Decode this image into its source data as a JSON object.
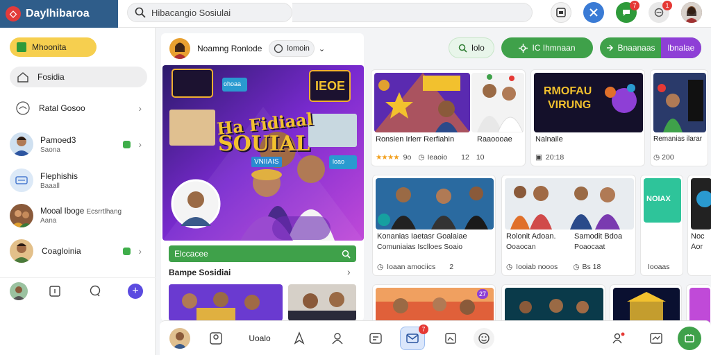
{
  "app": {
    "brand_name": "Daylhibaroa",
    "brand_glyph": "◇"
  },
  "search": {
    "placeholder": "Hibacangio Sosiulai"
  },
  "top_badges": {
    "chat": "7",
    "notifications": "1"
  },
  "sidebar": {
    "primary_label": "Mhoonita",
    "items": [
      {
        "label": "Fosidia",
        "sub": ""
      },
      {
        "label": "Ratal Gosoo",
        "sub": ""
      },
      {
        "label": "Pamoed3",
        "sub": "Saona"
      },
      {
        "label": "Flephishis",
        "sub": "Baaall"
      },
      {
        "label": "Mooal Iboge",
        "sub": "Aana",
        "extra": "Ecsrrtlhang"
      },
      {
        "label": "Coagloinia",
        "sub": ""
      }
    ]
  },
  "feed": {
    "user_name": "Noamng Ronlode",
    "chip_label": "lomoin",
    "hero_title_1": "Ha Fidiaal",
    "hero_title_2": "SOUIAL",
    "hero_tag": "VNIIAIS",
    "hero_chip_1": "ohoaa",
    "hero_chip_2": "loao",
    "hero_chip_3": "IEOE",
    "green_bar_label": "Elccacee",
    "section_title": "Bampe Sosidiai"
  },
  "actions": {
    "lolo": "lolo",
    "primary": "IC Ihmnaan",
    "secondary": "Bnaanaas",
    "tertiary": "lbnalae"
  },
  "cards_row1": [
    {
      "title": "Ronsien Irlerr Rerfiahin",
      "rating_value": "9o",
      "meta2": "Ieaoio",
      "meta3": ""
    },
    {
      "title": "Raaoooae",
      "rating_value": "",
      "meta2": "12",
      "meta3": "10"
    },
    {
      "title": "Nalnaile",
      "rating_value": "",
      "meta2": "20:18",
      "meta3": "",
      "banner_1": "RMOFAU",
      "banner_2": "VIRUNG"
    },
    {
      "title": "Remanias ilarar",
      "rating_value": "",
      "meta2": "200",
      "meta3": ""
    }
  ],
  "cards_row2": [
    {
      "title": "Konanias Iaetasr Goalaiae",
      "title2": "Comuniaias Isclloes Soaio",
      "meta": "Ioaan amociics",
      "meta_num": "2"
    },
    {
      "title": "Rolonit Adoan.",
      "title2": "Ooaocan",
      "meta": "Iooiab nooos",
      "meta_num": ""
    },
    {
      "title": "Samodit Bdoa",
      "title2": "Poaocaat",
      "meta": "Bs 18",
      "meta_num": ""
    },
    {
      "title": "",
      "title2": "",
      "meta": "Iooaas",
      "meta_num": "",
      "tile_label": "NOIAX"
    },
    {
      "title": "Noc",
      "title2": "Aor",
      "meta": "",
      "meta_num": ""
    }
  ],
  "row3_badge": "27",
  "bottom_badges": {
    "inbox": "7"
  },
  "bottom_labels": {
    "uloalo": "Uoalo"
  },
  "colors": {
    "brand_bar": "#2f5d8a",
    "accent_green": "#3fa14a",
    "accent_purple": "#8e3fd6",
    "badge_red": "#e53935",
    "pill_yellow": "#f6cf4f"
  }
}
